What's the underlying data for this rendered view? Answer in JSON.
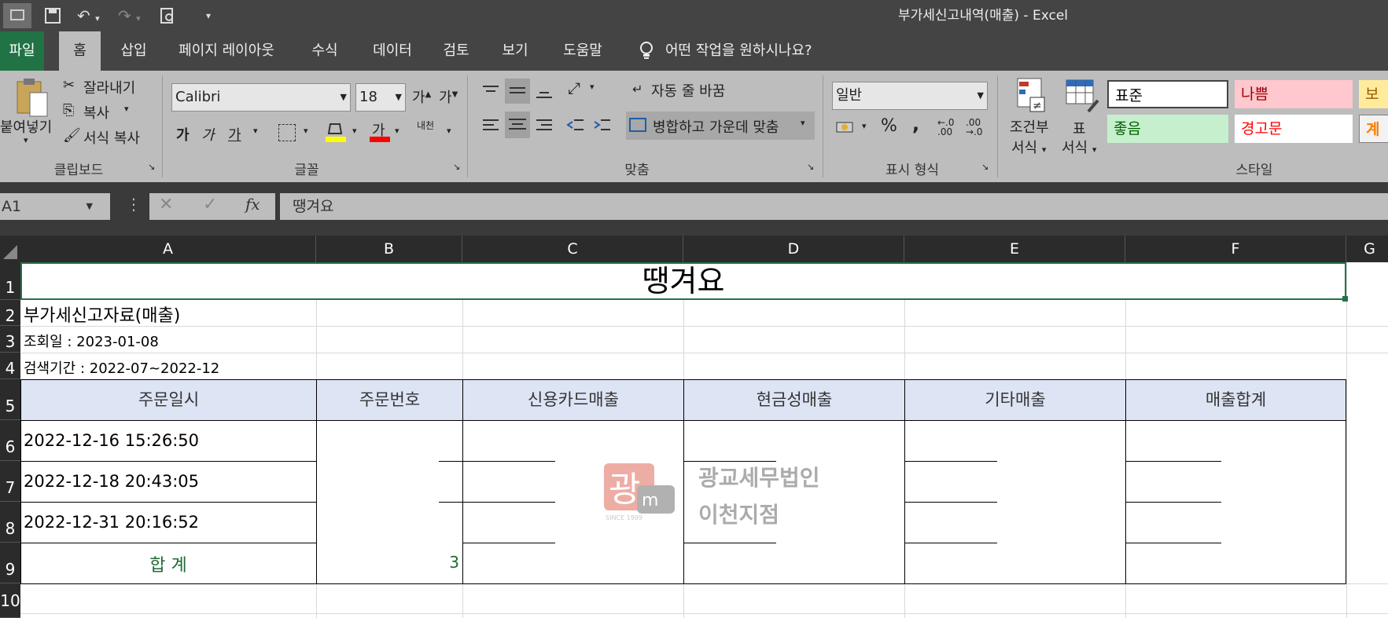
{
  "window": {
    "title": "부가세신고내역(매출)  -  Excel"
  },
  "tabs": {
    "file": "파일",
    "home": "홈",
    "insert": "삽입",
    "page_layout": "페이지 레이아웃",
    "formulas": "수식",
    "data": "데이터",
    "review": "검토",
    "view": "보기",
    "help": "도움말",
    "tell_me": "어떤 작업을 원하시나요?"
  },
  "ribbon": {
    "clipboard": {
      "paste": "붙여넣기",
      "cut": "잘라내기",
      "copy": "복사",
      "format_painter": "서식 복사",
      "label": "클립보드"
    },
    "font": {
      "name": "Calibri",
      "size": "18",
      "bold": "가",
      "italic": "가",
      "underline": "가",
      "grow": "가",
      "shrink": "가",
      "phonetic": "내천",
      "color_letter": "가",
      "label": "글꼴"
    },
    "alignment": {
      "wrap_text": "자동 줄 바꿈",
      "merge_center": "병합하고 가운데 맞춤",
      "label": "맞춤"
    },
    "number": {
      "format": "일반",
      "percent": "%",
      "comma": ",",
      "label": "표시 형식"
    },
    "styles": {
      "conditional": "조건부\n서식",
      "conditional_1": "조건부",
      "conditional_2": "서식",
      "table_1": "표",
      "table_2": "서식",
      "normal": "표준",
      "bad": "나쁨",
      "neutral": "보통",
      "good": "좋음",
      "warning": "경고문",
      "calc": "계산",
      "label": "스타일",
      "colors": {
        "bad_bg": "#ffc7ce",
        "bad_fg": "#9c0006",
        "good_bg": "#c6efce",
        "good_fg": "#006100",
        "neutral_bg": "#ffeb9c",
        "neutral_fg": "#9c5700",
        "warning_fg": "#ff0000"
      }
    }
  },
  "formula_bar": {
    "name_box": "A1",
    "value": "땡겨요"
  },
  "columns": [
    "A",
    "B",
    "C",
    "D",
    "E",
    "F",
    "G"
  ],
  "rows": [
    "1",
    "2",
    "3",
    "4",
    "5",
    "6",
    "7",
    "8",
    "9",
    "10"
  ],
  "sheet": {
    "title": "땡겨요",
    "subtitle": "부가세신고자료(매출)",
    "query_date": "조회일 : 2023-01-08",
    "search_period": "검색기간 : 2022-07~2022-12",
    "headers": [
      "주문일시",
      "주문번호",
      "신용카드매출",
      "현금성매출",
      "기타매출",
      "매출합계"
    ],
    "orders": [
      {
        "datetime": "2022-12-16 15:26:50"
      },
      {
        "datetime": "2022-12-18 20:43:05"
      },
      {
        "datetime": "2022-12-31 20:16:52"
      }
    ],
    "total_label": "합 계",
    "total_count": "3"
  },
  "watermark": {
    "line1": "광교세무법인",
    "line2": "이천지점",
    "logo_text": "광",
    "since": "SINCE 1999"
  },
  "colors": {
    "accent": "#217346",
    "header_fill": "#dde4f4",
    "total_text": "#1e6b35"
  }
}
